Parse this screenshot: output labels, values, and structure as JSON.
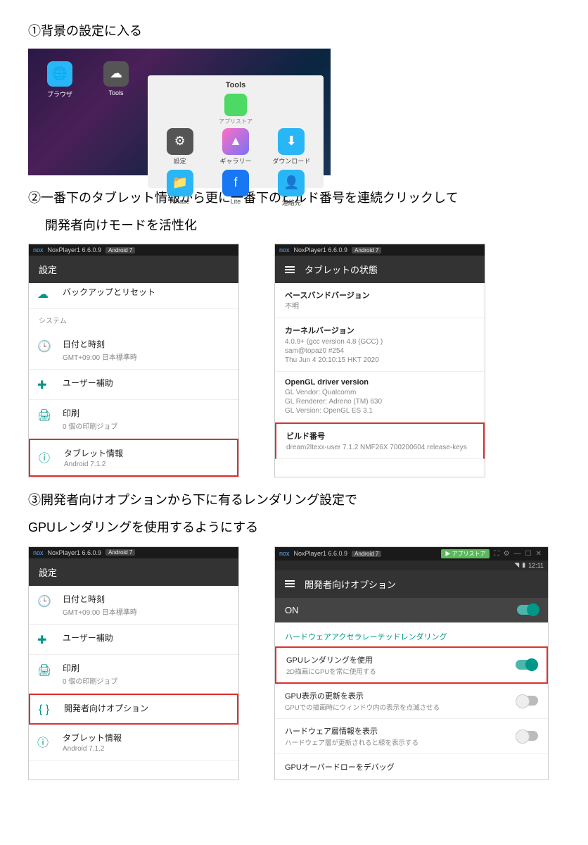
{
  "steps": {
    "s1": "①背景の設定に入る",
    "s2a": "②一番下のタブレット情報から更に一番下のビルド番号を連続クリックして",
    "s2b": "開発者向けモードを活性化",
    "s3a": "③開発者向けオプションから下に有るレンダリング設定で",
    "s3b": "GPUレンダリングを使用するようにする"
  },
  "desktop": {
    "browser": "ブラウザ",
    "tools_label": "Tools",
    "popup_title": "Tools",
    "appstore": "アプリストア",
    "settings": "設定",
    "gallery": "ギャラリー",
    "download": "ダウンロード",
    "amaze": "Amaze",
    "lite": "Lite",
    "contacts": "連絡先"
  },
  "nox": {
    "title": "NoxPlayer1 6.6.0.9",
    "badge": "Android 7",
    "appstore_btn": "▶ アプリストア",
    "time": "12:11"
  },
  "settings_header": "設定",
  "tablet_header": "タブレットの状態",
  "dev_header": "開発者向けオプション",
  "list1": {
    "backup": "バックアップとリセット",
    "system": "システム",
    "datetime_t": "日付と時刻",
    "datetime_s": "GMT+09:00 日本標準時",
    "access": "ユーザー補助",
    "print_t": "印刷",
    "print_s": "0 個の印刷ジョブ",
    "tablet_t": "タブレット情報",
    "tablet_s": "Android 7.1.2"
  },
  "status": {
    "baseband_t": "ベースバンドバージョン",
    "baseband_s": "不明",
    "kernel_t": "カーネルバージョン",
    "kernel_s1": "4.0.9+ (gcc version 4.8 (GCC) )",
    "kernel_s2": "sam@topaz0 #254",
    "kernel_s3": "Thu Jun 4 20:10:15 HKT 2020",
    "gl_t": "OpenGL driver version",
    "gl_s1": "GL Vendor: Qualcomm",
    "gl_s2": "GL Renderer: Adreno (TM) 630",
    "gl_s3": "GL Version: OpenGL ES 3.1",
    "build_t": "ビルド番号",
    "build_s": "dream2ltexx-user 7.1.2 NMF26X 700200604 release-keys"
  },
  "list2": {
    "dev_t": "開発者向けオプション"
  },
  "dev": {
    "on": "ON",
    "section": "ハードウェアアクセラレーテッドレンダリング",
    "gpu_t": "GPUレンダリングを使用",
    "gpu_s": "2D描画にGPUを常に使用する",
    "upd_t": "GPU表示の更新を表示",
    "upd_s": "GPUでの描画時にウィンドウ内の表示を点滅させる",
    "hw_t": "ハードウェア層情報を表示",
    "hw_s": "ハードウェア層が更新されると緑を表示する",
    "overdraw": "GPUオーバードローをデバッグ"
  }
}
